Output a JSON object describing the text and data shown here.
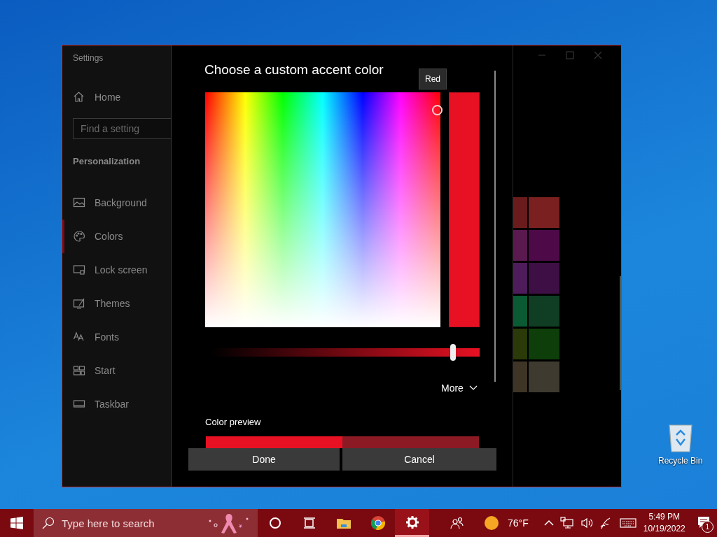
{
  "settings_window": {
    "title": "Settings",
    "home": "Home",
    "search": {
      "placeholder": "Find a setting"
    },
    "section": "Personalization",
    "sidebar": {
      "items": [
        {
          "label": "Background",
          "selected": false
        },
        {
          "label": "Colors",
          "selected": true
        },
        {
          "label": "Lock screen",
          "selected": false
        },
        {
          "label": "Themes",
          "selected": false
        },
        {
          "label": "Fonts",
          "selected": false
        },
        {
          "label": "Start",
          "selected": false
        },
        {
          "label": "Taskbar",
          "selected": false
        }
      ]
    },
    "swatches": [
      {
        "color": "#6a1c1c"
      },
      {
        "color": "#7a2020"
      },
      {
        "color": "#5a1a50"
      },
      {
        "color": "#4e0a48"
      },
      {
        "color": "#4e1c5a"
      },
      {
        "color": "#3e0f44"
      },
      {
        "color": "#0a5a34"
      },
      {
        "color": "#0f3e24"
      },
      {
        "color": "#2a3a08"
      },
      {
        "color": "#0e3e0a"
      },
      {
        "color": "#3e3526"
      },
      {
        "color": "#3e3a30"
      }
    ]
  },
  "dialog": {
    "title": "Choose a custom accent color",
    "tooltip": "Red",
    "slider": {
      "level": 0.9
    },
    "more": "More",
    "preview_label": "Color preview",
    "preview": [
      {
        "color": "#e81123"
      },
      {
        "color": "#8c1a24"
      }
    ],
    "buttons": [
      {
        "label": "Done"
      },
      {
        "label": "Cancel"
      }
    ]
  },
  "desktop": {
    "recycle_bin": "Recycle Bin"
  },
  "taskbar": {
    "search": {
      "placeholder": "Type here to search"
    },
    "apps": [
      {
        "kind": "cortana",
        "active": false
      },
      {
        "kind": "taskview",
        "active": false
      },
      {
        "kind": "explorer",
        "active": false
      },
      {
        "kind": "chrome",
        "active": false
      },
      {
        "kind": "settings",
        "active": true
      }
    ],
    "weather": "76°F",
    "time": "5:49 PM",
    "date": "10/19/2022",
    "notifications": "1"
  }
}
